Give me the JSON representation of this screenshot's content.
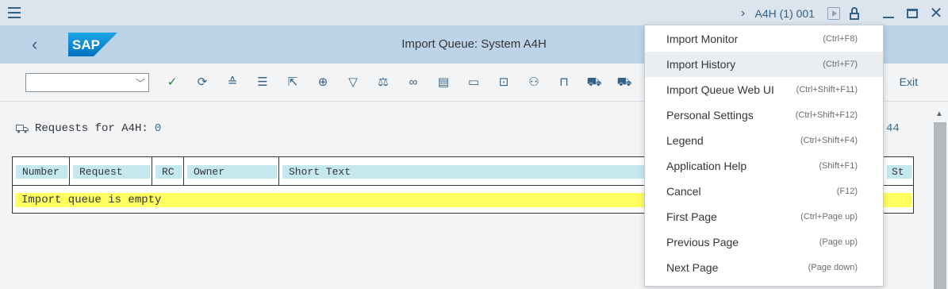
{
  "window": {
    "system_info": "A4H (1) 001"
  },
  "header": {
    "logo_text": "SAP",
    "title": "Import Queue: System A4H"
  },
  "toolbar": {
    "command_field_value": "",
    "exit_label": "Exit",
    "icons": [
      "check-icon",
      "refresh-icon",
      "align-top-icon",
      "filter-lines-icon",
      "cursor-select-icon",
      "zoom-icon",
      "funnel-icon",
      "balance-icon",
      "glasses-icon",
      "document-icon",
      "card-icon",
      "search-doc-icon",
      "people-icon",
      "lock-icon",
      "truck-people-icon",
      "trucks-icon"
    ]
  },
  "content": {
    "requests_label": "Requests for A4H:",
    "requests_count": "0",
    "right_number": "44",
    "table": {
      "columns": [
        "Number",
        "Request",
        "RC",
        "Owner",
        "Short Text",
        "St"
      ],
      "empty_message": "Import queue is empty"
    }
  },
  "menu": {
    "items": [
      {
        "label": "Import Monitor",
        "shortcut": "(Ctrl+F8)"
      },
      {
        "label": "Import History",
        "shortcut": "(Ctrl+F7)"
      },
      {
        "label": "Import Queue Web UI",
        "shortcut": "(Ctrl+Shift+F11)"
      },
      {
        "label": "Personal Settings",
        "shortcut": "(Ctrl+Shift+F12)"
      },
      {
        "label": "Legend",
        "shortcut": "(Ctrl+Shift+F4)"
      },
      {
        "label": "Application Help",
        "shortcut": "(Shift+F1)"
      },
      {
        "label": "Cancel",
        "shortcut": "(F12)"
      },
      {
        "label": "First Page",
        "shortcut": "(Ctrl+Page up)"
      },
      {
        "label": "Previous Page",
        "shortcut": "(Page up)"
      },
      {
        "label": "Next Page",
        "shortcut": "(Page down)"
      }
    ],
    "highlighted_index": 1
  },
  "colors": {
    "accent": "#346187",
    "header_bg": "#bcd3e8",
    "empty_row_bg": "#ffff60",
    "column_header_bg": "#c5e8ee"
  }
}
